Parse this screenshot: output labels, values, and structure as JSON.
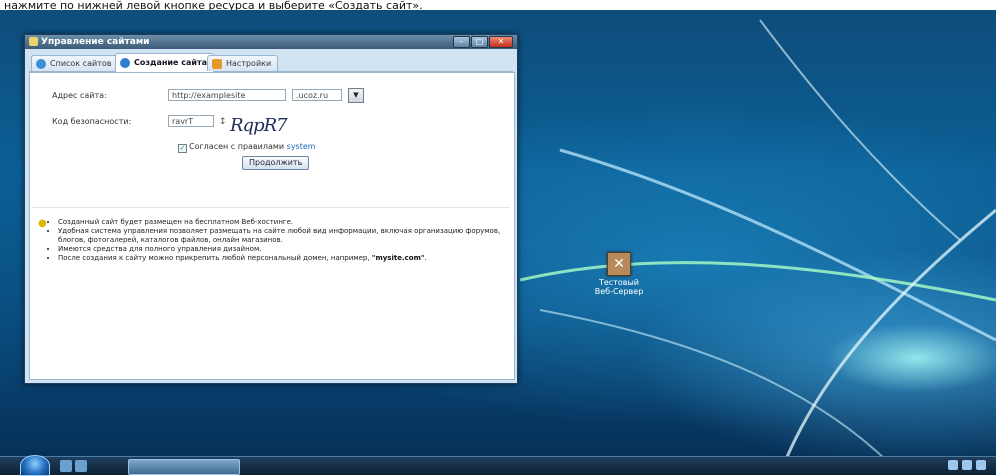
{
  "caption": "нажмите по нижней левой кнопке ресурса и выберите «Создать сайт».",
  "window": {
    "title": "Управление сайтами",
    "tabs": [
      {
        "label": "Список сайтов",
        "active": false
      },
      {
        "label": "Создание сайта",
        "active": true
      },
      {
        "label": "Настройки",
        "active": false
      }
    ]
  },
  "form": {
    "address_label": "Адрес сайта:",
    "address_value": "http://examplesite",
    "domain_value": ".ucoz.ru",
    "security_label": "Код безопасности:",
    "security_value": "ravrT",
    "captcha_text": "RqpR7",
    "agree_text": "Согласен с правилами",
    "agree_link": "system",
    "agree_checked": true,
    "continue_label": "Продолжить"
  },
  "info_items": [
    "Созданный сайт будет размещен на бесплатном Веб-хостинге.",
    "Удобная система управления позволяет размещать на сайте любой вид информации, включая организацию форумов, блогов, фотогалерей, каталогов файлов, онлайн магазинов.",
    "Имеются средства для полного управления дизайном.",
    "После создания к сайту можно прикрепить любой персональный домен, например,"
  ],
  "info_domain_example": "\"mysite.com\"",
  "desktop_icon": {
    "label": "Тестовый Веб-Сервер",
    "icon": "tools-icon"
  },
  "colors": {
    "accent": "#1a68b8",
    "desktop": "#0b5f95",
    "title_bar": "#3b5b78"
  }
}
